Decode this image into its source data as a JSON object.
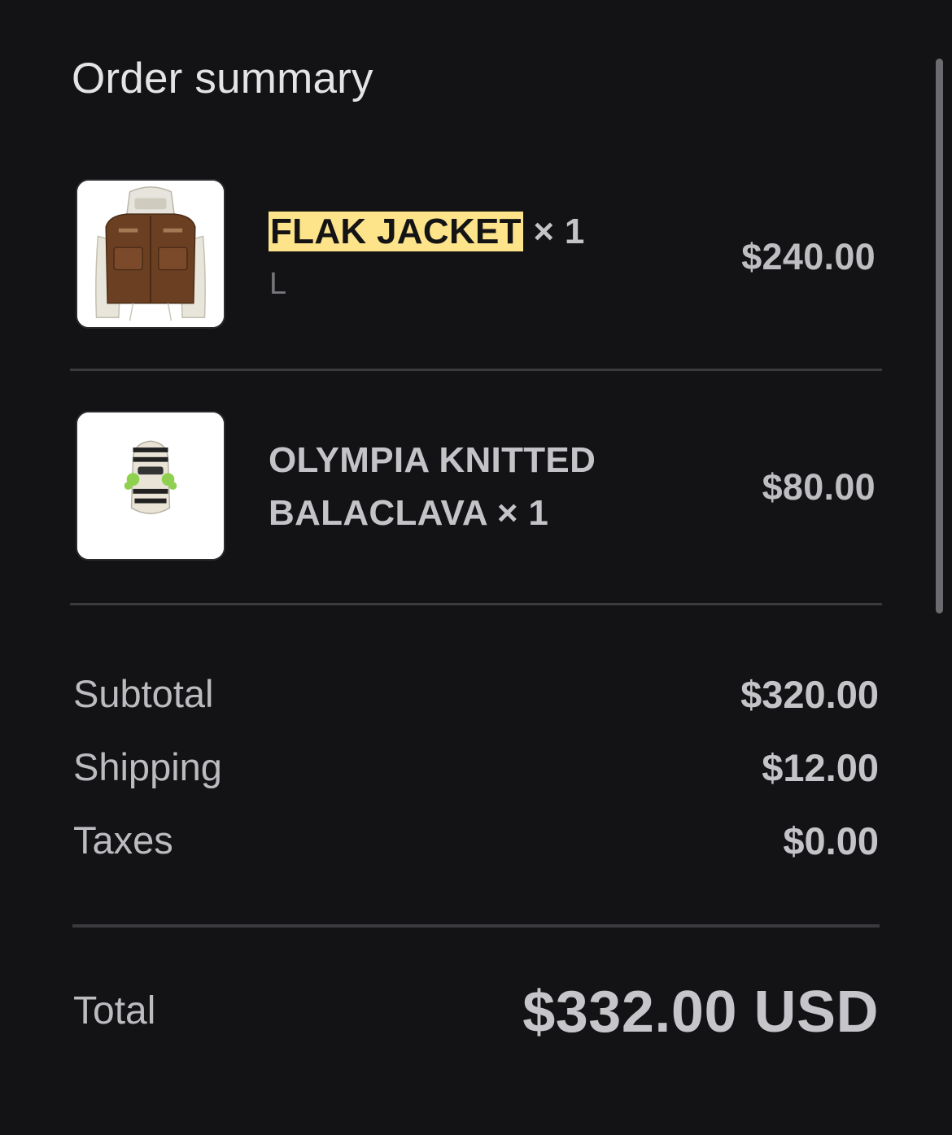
{
  "header": {
    "title": "Order summary"
  },
  "items": [
    {
      "name": "FLAK JACKET",
      "quantity": "× 1",
      "variant": "L",
      "price": "$240.00",
      "image_icon": "flak-jacket-image"
    },
    {
      "name_line1": "OLYMPIA KNITTED",
      "name_line2": "BALACLAVA",
      "quantity": "× 1",
      "price": "$80.00",
      "image_icon": "balaclava-image"
    }
  ],
  "summary": {
    "subtotal_label": "Subtotal",
    "subtotal_value": "$320.00",
    "shipping_label": "Shipping",
    "shipping_value": "$12.00",
    "taxes_label": "Taxes",
    "taxes_value": "$0.00",
    "total_label": "Total",
    "total_value": "$332.00 USD"
  },
  "colors": {
    "background": "#131315",
    "highlight": "#fde38a",
    "text": "#c2c2c6"
  }
}
